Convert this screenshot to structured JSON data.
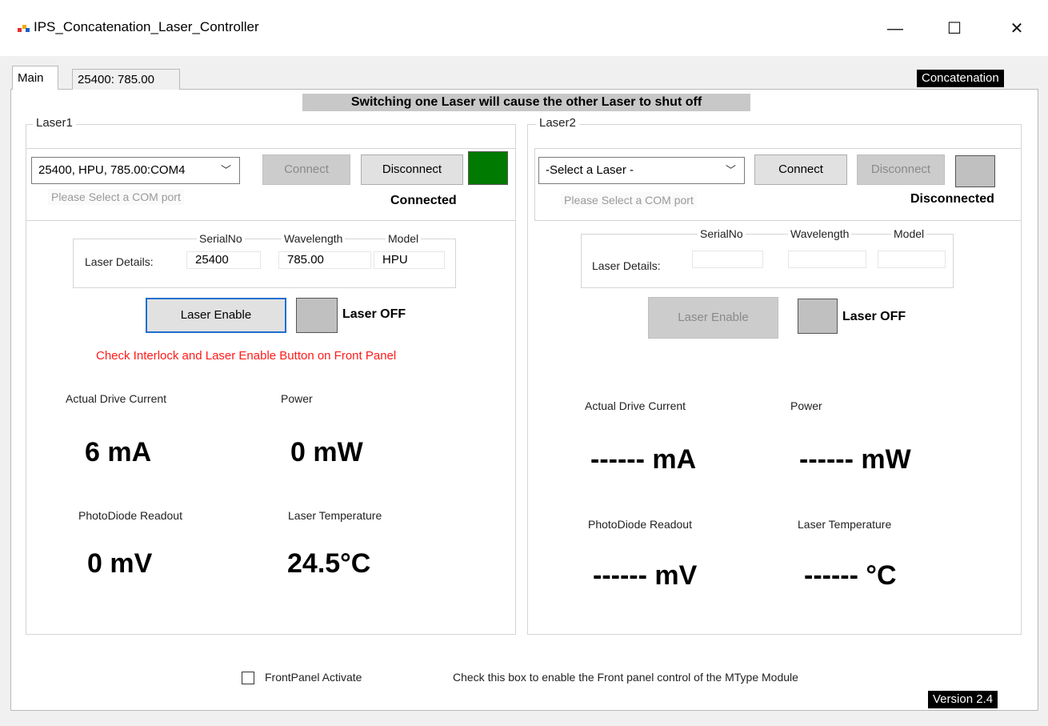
{
  "window": {
    "title": "IPS_Concatenation_Laser_Controller",
    "minimize": "—",
    "maximize": "☐",
    "close": "✕"
  },
  "tabs": [
    {
      "label": "Main",
      "selected": true
    },
    {
      "label": "25400: 785.00",
      "selected": false
    }
  ],
  "header": {
    "mode_label": "Concatenation",
    "warning": "Switching one Laser will cause the other Laser to shut off"
  },
  "laser1": {
    "group_title": "Laser1",
    "port_select": "25400, HPU, 785.00:COM4",
    "connect_label": "Connect",
    "disconnect_label": "Disconnect",
    "connection_status": "Connected",
    "status_color": "#007a00",
    "com_hint": "Please Select a COM port",
    "details_label": "Laser Details:",
    "serial_header": "SerialNo",
    "wavelength_header": "Wavelength",
    "model_header": "Model",
    "serial_value": "25400",
    "wavelength_value": "785.00",
    "model_value": "HPU",
    "enable_label": "Laser Enable",
    "laser_state": "Laser OFF",
    "laser_led_color": "#c0c0c0",
    "interlock_warning": "Check Interlock and Laser Enable Button on Front Panel",
    "drive_current_label": "Actual Drive Current",
    "drive_current_value": "6 mA",
    "power_label": "Power",
    "power_value": "0 mW",
    "photodiode_label": "PhotoDiode Readout",
    "photodiode_value": "0 mV",
    "temperature_label": "Laser Temperature",
    "temperature_value": "24.5°C"
  },
  "laser2": {
    "group_title": "Laser2",
    "port_select": "-Select a Laser -",
    "connect_label": "Connect",
    "disconnect_label": "Disconnect",
    "connection_status": "Disconnected",
    "status_color": "#c0c0c0",
    "com_hint": "Please Select a COM port",
    "details_label": "Laser Details:",
    "serial_header": "SerialNo",
    "wavelength_header": "Wavelength",
    "model_header": "Model",
    "enable_label": "Laser Enable",
    "laser_state": "Laser OFF",
    "laser_led_color": "#c0c0c0",
    "drive_current_label": "Actual Drive Current",
    "drive_current_value": "------ mA",
    "power_label": "Power",
    "power_value": "------ mW",
    "photodiode_label": "PhotoDiode Readout",
    "photodiode_value": "------ mV",
    "temperature_label": "Laser Temperature",
    "temperature_value": "------ °C"
  },
  "footer": {
    "frontpanel_label": "FrontPanel Activate",
    "frontpanel_checked": false,
    "frontpanel_help": "Check this box to enable the Front panel control of the MType Module",
    "version": "Version 2.4"
  }
}
